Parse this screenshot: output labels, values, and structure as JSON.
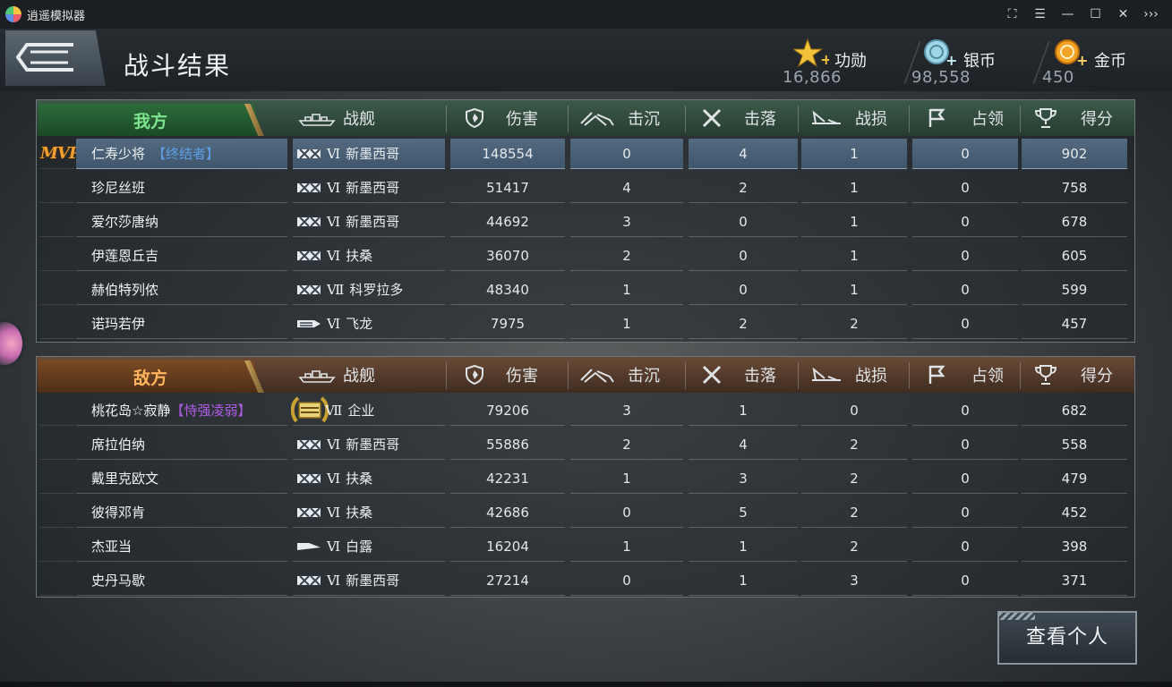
{
  "window": {
    "title": "逍遥模拟器",
    "controls": [
      "⛶",
      "☰",
      "—",
      "☐",
      "✕",
      "›››"
    ]
  },
  "header": {
    "title": "战斗结果",
    "currencies": [
      {
        "icon": "star-plus-icon",
        "label": "功勋",
        "value": "16,866"
      },
      {
        "icon": "silver-coin-icon",
        "label": "银币",
        "value": "98,558"
      },
      {
        "icon": "gold-coin-icon",
        "label": "金币",
        "value": "450"
      }
    ]
  },
  "columns": {
    "ship": "战舰",
    "damage": "伤害",
    "sunk": "击沉",
    "downed": "击落",
    "loss": "战损",
    "occupy": "占领",
    "score": "得分"
  },
  "ally": {
    "label": "我方",
    "rows": [
      {
        "mvp": "MVP",
        "name": "仁寿少将",
        "tag": "【终结者】",
        "ship_type": "destroyer",
        "tier": "Ⅵ",
        "ship": "新墨西哥",
        "damage": "148554",
        "sunk": "0",
        "downed": "4",
        "loss": "1",
        "occupy": "0",
        "score": "902"
      },
      {
        "name": "珍尼丝班",
        "ship_type": "battleship",
        "tier": "Ⅵ",
        "ship": "新墨西哥",
        "damage": "51417",
        "sunk": "4",
        "downed": "2",
        "loss": "1",
        "occupy": "0",
        "score": "758"
      },
      {
        "name": "爱尔莎唐纳",
        "ship_type": "battleship",
        "tier": "Ⅵ",
        "ship": "新墨西哥",
        "damage": "44692",
        "sunk": "3",
        "downed": "0",
        "loss": "1",
        "occupy": "0",
        "score": "678"
      },
      {
        "name": "伊莲恩丘吉",
        "ship_type": "battleship",
        "tier": "Ⅵ",
        "ship": "扶桑",
        "damage": "36070",
        "sunk": "2",
        "downed": "0",
        "loss": "1",
        "occupy": "0",
        "score": "605"
      },
      {
        "name": "赫伯特列侬",
        "ship_type": "battleship",
        "tier": "Ⅶ",
        "ship": "科罗拉多",
        "damage": "48340",
        "sunk": "1",
        "downed": "0",
        "loss": "1",
        "occupy": "0",
        "score": "599"
      },
      {
        "name": "诺玛若伊",
        "ship_type": "carrier",
        "tier": "Ⅵ",
        "ship": "飞龙",
        "damage": "7975",
        "sunk": "1",
        "downed": "2",
        "loss": "2",
        "occupy": "0",
        "score": "457"
      }
    ]
  },
  "enemy": {
    "label": "敌方",
    "rows": [
      {
        "name": "桃花岛☆寂静",
        "tag": "【恃强凌弱】",
        "ship_type": "carrier-elite",
        "tier": "Ⅶ",
        "ship": "企业",
        "damage": "79206",
        "sunk": "3",
        "downed": "1",
        "loss": "0",
        "occupy": "0",
        "score": "682"
      },
      {
        "name": "席拉伯纳",
        "ship_type": "battleship",
        "tier": "Ⅵ",
        "ship": "新墨西哥",
        "damage": "55886",
        "sunk": "2",
        "downed": "4",
        "loss": "2",
        "occupy": "0",
        "score": "558"
      },
      {
        "name": "戴里克欧文",
        "ship_type": "battleship",
        "tier": "Ⅵ",
        "ship": "扶桑",
        "damage": "42231",
        "sunk": "1",
        "downed": "3",
        "loss": "2",
        "occupy": "0",
        "score": "479"
      },
      {
        "name": "彼得邓肯",
        "ship_type": "battleship",
        "tier": "Ⅵ",
        "ship": "扶桑",
        "damage": "42686",
        "sunk": "0",
        "downed": "5",
        "loss": "2",
        "occupy": "0",
        "score": "452"
      },
      {
        "name": "杰亚当",
        "ship_type": "cruiser",
        "tier": "Ⅵ",
        "ship": "白露",
        "damage": "16204",
        "sunk": "1",
        "downed": "1",
        "loss": "2",
        "occupy": "0",
        "score": "398"
      },
      {
        "name": "史丹马歇",
        "ship_type": "battleship",
        "tier": "Ⅵ",
        "ship": "新墨西哥",
        "damage": "27214",
        "sunk": "0",
        "downed": "1",
        "loss": "3",
        "occupy": "0",
        "score": "371"
      }
    ]
  },
  "actions": {
    "view_personal": "查看个人"
  },
  "colors": {
    "ally_accent": "#7fe48e",
    "enemy_accent": "#ffb560",
    "mvp_highlight": "#4a6178",
    "tag_blue": "#5d9fe6",
    "tag_purple": "#b15ce6"
  }
}
